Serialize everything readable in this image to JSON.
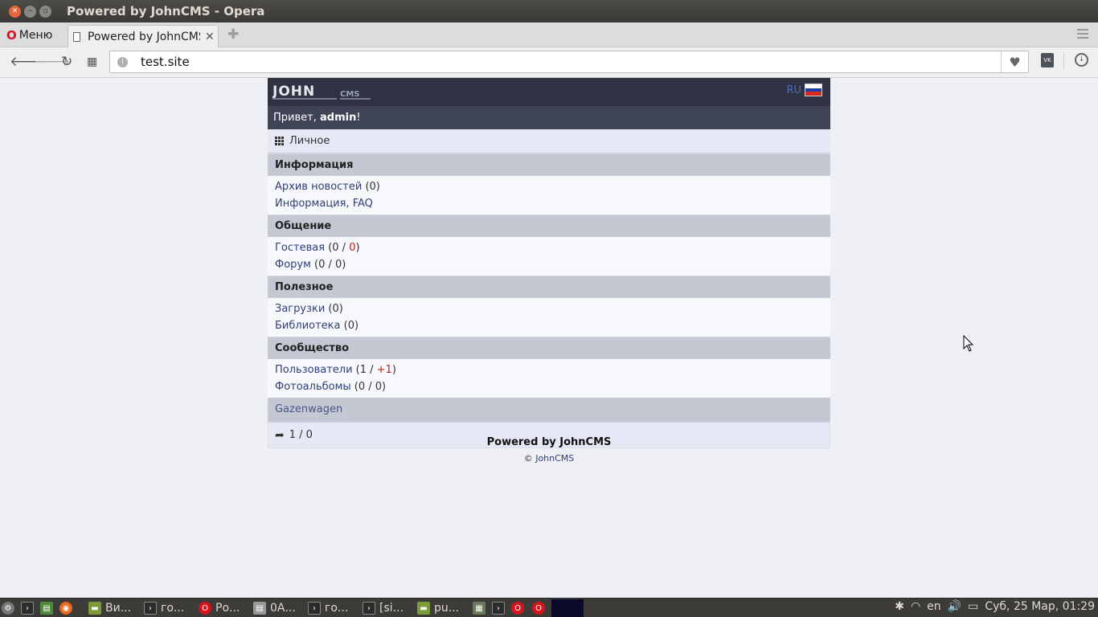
{
  "window": {
    "title": "Powered by JohnCMS - Opera"
  },
  "browser": {
    "menu_label": "Меню",
    "tab_title": "Powered by JohnCMS",
    "url": "test.site"
  },
  "site": {
    "logo_alt": "JOHN CMS",
    "lang": "RU",
    "greeting_prefix": "Привет, ",
    "username": "admin",
    "greeting_suffix": "!",
    "personal_label": "Личное",
    "sections": [
      {
        "title": "Информация",
        "items": [
          {
            "link": "Архив новостей",
            "count": " (0)"
          },
          {
            "link": "Информация, FAQ",
            "count": ""
          }
        ]
      },
      {
        "title": "Общение",
        "items": [
          {
            "link": "Гостевая",
            "count_a": " (0 / ",
            "count_red": "0",
            "count_b": ")"
          },
          {
            "link": "Форум",
            "count": " (0 / 0)"
          }
        ]
      },
      {
        "title": "Полезное",
        "items": [
          {
            "link": "Загрузки",
            "count": " (0)"
          },
          {
            "link": "Библиотека",
            "count": " (0)"
          }
        ]
      },
      {
        "title": "Сообщество",
        "items": [
          {
            "link": "Пользователи",
            "count_a": " (1 / ",
            "count_red": "+1",
            "count_b": ")"
          },
          {
            "link": "Фотоальбомы",
            "count": " (0 / 0)"
          }
        ]
      }
    ],
    "gazenwagen": "Gazenwagen",
    "counter": "1 / 0",
    "powered": "Powered by JohnCMS",
    "copyright_symbol": "© ",
    "copyright_link": "JohnCMS"
  },
  "taskbar": {
    "items": [
      "Ви...",
      "го...",
      "Ро...",
      "0А...",
      "го...",
      "[si...",
      "pu..."
    ],
    "lang": "en",
    "clock": "Суб, 25 Мар, 01:29"
  },
  "colors": {
    "opera_red": "#d6141c",
    "header_bg": "#2f3242",
    "section_bg": "#c4c8d2",
    "link": "#304078"
  }
}
